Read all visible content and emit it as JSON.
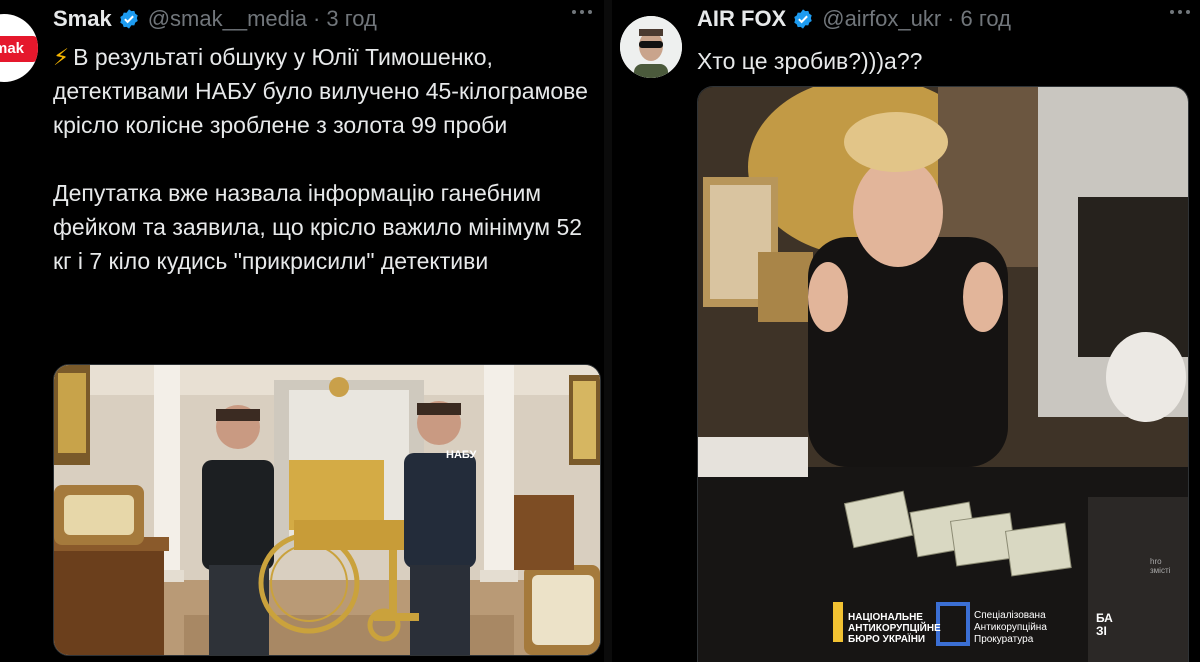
{
  "tweet1": {
    "author_name": "Smak",
    "handle": "@smak__media",
    "separator": "·",
    "time": "3 год",
    "avatar_text": "mak",
    "text": "В результаті обшуку у Юлії Тимошенко, детективами НАБУ було вилучено 45-кілограмове крісло колісне зроблене з золота 99 проби\n\nДепутатка вже назвала інформацію ганебним фейком та заявила, що крісло важило мінімум 52 кг і 7 кіло кудись \"прикрисили\" детективи",
    "bolt_icon": "⚡",
    "image": {
      "vest_label": "НАБУ"
    }
  },
  "tweet2": {
    "author_name": "AIR FOX",
    "handle": "@airfox_ukr",
    "separator": "·",
    "time": "6 год",
    "text": "Хто це зробив?)))а??",
    "image": {
      "watermark_top": "hro",
      "watermark_bottom": "змісті",
      "nabu_logo": "НАЦІОНАЛЬНЕ\nАНТИКОРУПЦІЙНЕ\nБЮРО УКРАЇНИ",
      "sap_logo": "Спеціалізована\nАнтикорупційна\nПрокуратура",
      "bazi_logo": "БА\nЗІ"
    }
  },
  "colors": {
    "background": "#000000",
    "text": "#e7e9ea",
    "secondary_text": "#71767b",
    "verified": "#1d9bf0",
    "smak_brand": "#e5182c"
  }
}
